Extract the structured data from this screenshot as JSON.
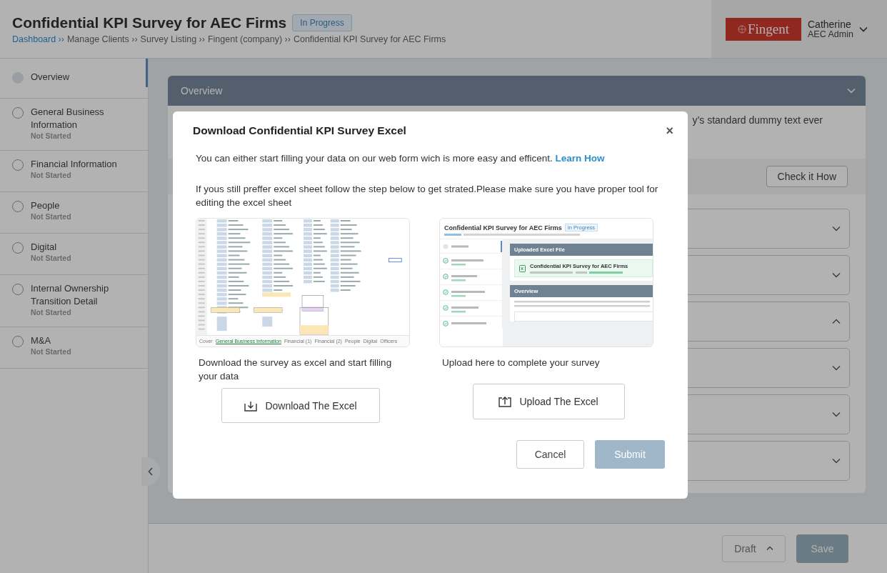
{
  "header": {
    "title": "Confidential KPI Survey for AEC Firms",
    "status_badge": "In Progress",
    "breadcrumb": [
      {
        "text": "Dashboard ››",
        "kind": "link"
      },
      {
        "text": "Manage Clients ››",
        "kind": "plain"
      },
      {
        "text": "Survey Listing ››",
        "kind": "plain"
      },
      {
        "text": "Fingent (company) ››",
        "kind": "plain"
      },
      {
        "text": "Confidential KPI Survey for AEC Firms",
        "kind": "plain"
      }
    ],
    "logo": "Fingent",
    "user": {
      "name": "Catherine",
      "role": "AEC Admin"
    }
  },
  "sidebar": {
    "items": [
      {
        "title": "Overview",
        "selected": true
      },
      {
        "title": "General Business Information",
        "status": "Not Started",
        "selected": false
      },
      {
        "title": "Financial Information",
        "status": "Not Started",
        "selected": false
      },
      {
        "title": "People",
        "status": "Not Started",
        "selected": false
      },
      {
        "title": "Digital",
        "status": "Not Started",
        "selected": false
      },
      {
        "title": "Internal Ownership Transition Detail",
        "status": "Not Started",
        "selected": false
      },
      {
        "title": "M&A",
        "status": "Not Started",
        "selected": false
      }
    ]
  },
  "overview": {
    "title": "Overview",
    "text": "y’s standard dummy text ever",
    "button": "Check it How",
    "sections": [
      {
        "expanded": false
      },
      {
        "expanded": false
      },
      {
        "expanded": true
      },
      {
        "expanded": false
      },
      {
        "expanded": false
      },
      {
        "expanded": false
      }
    ]
  },
  "footer": {
    "draft": "Draft",
    "save": "Save"
  },
  "modal": {
    "title": "Download Confidential KPI Survey Excel",
    "close": "×",
    "intro": "You can either start filling your data on our web form wich is more easy and efficent.",
    "intro_link": "Learn How",
    "instruction": "If yous still preffer excel sheet follow the step below to get strated.Please make sure you have proper tool for editing the excel sheet",
    "download": {
      "caption": "Download the survey as excel and start filling your data",
      "button": "Download The Excel",
      "sheet_tabs": [
        {
          "label": "Cover",
          "selected": false
        },
        {
          "label": "General Business Information",
          "selected": true
        },
        {
          "label": "Financial (1)",
          "selected": false
        },
        {
          "label": "Financial (2)",
          "selected": false
        },
        {
          "label": "People",
          "selected": false
        },
        {
          "label": "Digital",
          "selected": false
        },
        {
          "label": "Officers",
          "selected": false
        }
      ]
    },
    "upload": {
      "caption": "Upload here to complete your survey",
      "button": "Upload The Excel",
      "preview": {
        "title": "Confidential KPI Survey for AEC Firms",
        "badge": "In Progress",
        "file_panel": "Uploaded Excel File",
        "file_name": "Confidential KPI Survey for AEC Firms",
        "overview_title": "Overview"
      }
    },
    "cancel": "Cancel",
    "submit": "Submit"
  }
}
